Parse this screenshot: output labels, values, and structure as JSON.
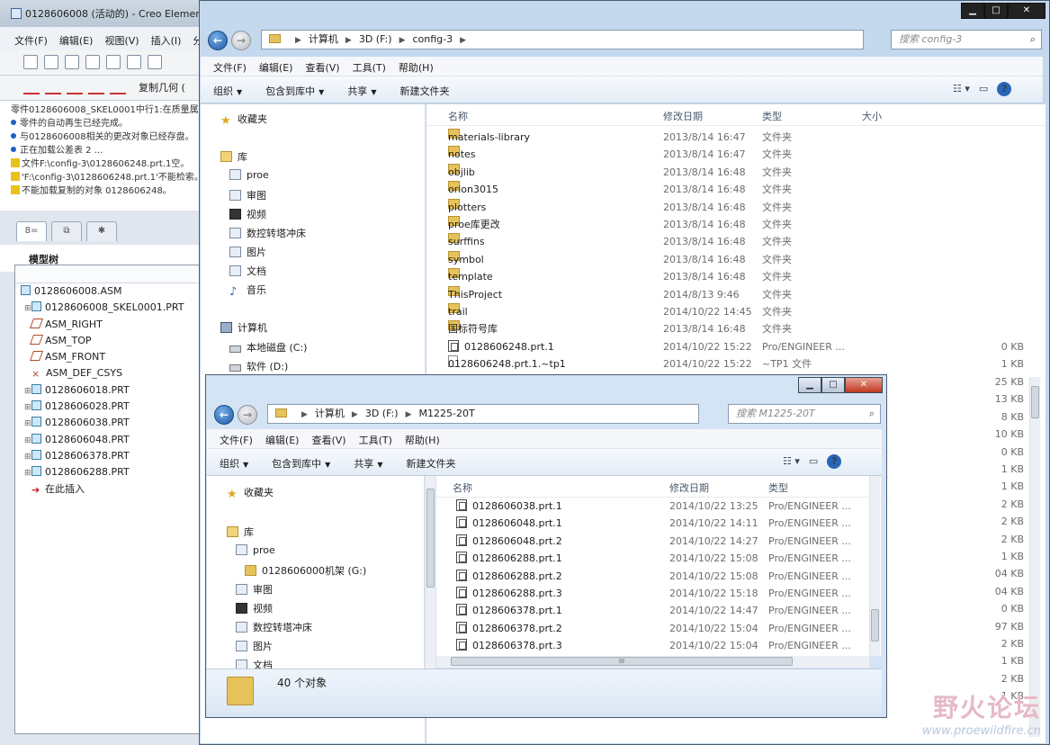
{
  "creo": {
    "title": "0128606008 (活动的) - Creo Element",
    "menu": [
      "文件(F)",
      "编辑(E)",
      "视图(V)",
      "插入(I)",
      "分"
    ],
    "toolbar_label": "复制几何 (",
    "messages": [
      {
        "kind": "plain",
        "text": "零件0128606008_SKEL0001中行1:在质量属"
      },
      {
        "kind": "dot",
        "text": "零件的自动再生已经完成。"
      },
      {
        "kind": "dot",
        "text": "与0128606008相关的更改对象已经存盘。"
      },
      {
        "kind": "dot",
        "text": "正在加载公差表 2 ..."
      },
      {
        "kind": "warn",
        "text": "文件F:\\config-3\\0128606248.prt.1空。"
      },
      {
        "kind": "warn",
        "text": "'F:\\config-3\\0128606248.prt.1'不能检索。"
      },
      {
        "kind": "warn",
        "text": "不能加载复制的对象 0128606248。"
      }
    ],
    "tree_title": "模型树",
    "tree": [
      {
        "pm": "",
        "icon": "asm",
        "label": "0128606008.ASM",
        "indent": 0
      },
      {
        "pm": "+",
        "icon": "part",
        "label": "0128606008_SKEL0001.PRT",
        "indent": 1
      },
      {
        "pm": "",
        "icon": "plane",
        "label": "ASM_RIGHT",
        "indent": 1
      },
      {
        "pm": "",
        "icon": "plane",
        "label": "ASM_TOP",
        "indent": 1
      },
      {
        "pm": "",
        "icon": "plane",
        "label": "ASM_FRONT",
        "indent": 1
      },
      {
        "pm": "",
        "icon": "csys",
        "label": "ASM_DEF_CSYS",
        "indent": 1
      },
      {
        "pm": "+",
        "icon": "part",
        "label": "0128606018.PRT",
        "indent": 1
      },
      {
        "pm": "+",
        "icon": "part",
        "label": "0128606028.PRT",
        "indent": 1
      },
      {
        "pm": "+",
        "icon": "part",
        "label": "0128606038.PRT",
        "indent": 1
      },
      {
        "pm": "+",
        "icon": "part",
        "label": "0128606048.PRT",
        "indent": 1
      },
      {
        "pm": "+",
        "icon": "part",
        "label": "0128606378.PRT",
        "indent": 1
      },
      {
        "pm": "+",
        "icon": "part",
        "label": "0128606288.PRT",
        "indent": 1
      },
      {
        "pm": "",
        "icon": "arrow",
        "label": "在此插入",
        "indent": 1
      }
    ]
  },
  "explorer1": {
    "path": [
      "计算机",
      "3D (F:)",
      "config-3"
    ],
    "search_placeholder": "搜索 config-3",
    "menu": [
      "文件(F)",
      "编辑(E)",
      "查看(V)",
      "工具(T)",
      "帮助(H)"
    ],
    "commands": [
      "组织",
      "包含到库中",
      "共享",
      "新建文件夹"
    ],
    "nav": [
      {
        "icon": "star",
        "label": "收藏夹"
      },
      {
        "icon": "lib",
        "label": "库"
      },
      {
        "icon": "doc",
        "label": "proe"
      },
      {
        "icon": "doc",
        "label": "审图"
      },
      {
        "icon": "vid",
        "label": "视频"
      },
      {
        "icon": "doc",
        "label": "数控转塔冲床"
      },
      {
        "icon": "doc",
        "label": "图片"
      },
      {
        "icon": "doc",
        "label": "文档"
      },
      {
        "icon": "music",
        "label": "音乐"
      },
      {
        "icon": "pc",
        "label": "计算机"
      },
      {
        "icon": "drv",
        "label": "本地磁盘 (C:)"
      },
      {
        "icon": "drv",
        "label": "软件 (D:)"
      }
    ],
    "columns": [
      "名称",
      "修改日期",
      "类型",
      "大小"
    ],
    "files": [
      {
        "icon": "folder",
        "name": "materials-library",
        "date": "2013/8/14 16:47",
        "type": "文件夹",
        "size": ""
      },
      {
        "icon": "folder",
        "name": "notes",
        "date": "2013/8/14 16:47",
        "type": "文件夹",
        "size": ""
      },
      {
        "icon": "folder",
        "name": "objlib",
        "date": "2013/8/14 16:48",
        "type": "文件夹",
        "size": ""
      },
      {
        "icon": "folder",
        "name": "orion3015",
        "date": "2013/8/14 16:48",
        "type": "文件夹",
        "size": ""
      },
      {
        "icon": "folder",
        "name": "plotters",
        "date": "2013/8/14 16:48",
        "type": "文件夹",
        "size": ""
      },
      {
        "icon": "folder",
        "name": "proe库更改",
        "date": "2013/8/14 16:48",
        "type": "文件夹",
        "size": ""
      },
      {
        "icon": "folder",
        "name": "surffins",
        "date": "2013/8/14 16:48",
        "type": "文件夹",
        "size": ""
      },
      {
        "icon": "folder",
        "name": "symbol",
        "date": "2013/8/14 16:48",
        "type": "文件夹",
        "size": ""
      },
      {
        "icon": "folder",
        "name": "template",
        "date": "2013/8/14 16:48",
        "type": "文件夹",
        "size": ""
      },
      {
        "icon": "folder",
        "name": "ThisProject",
        "date": "2014/8/13 9:46",
        "type": "文件夹",
        "size": ""
      },
      {
        "icon": "folder",
        "name": "trail",
        "date": "2014/10/22 14:45",
        "type": "文件夹",
        "size": ""
      },
      {
        "icon": "folder",
        "name": "国标符号库",
        "date": "2013/8/14 16:48",
        "type": "文件夹",
        "size": ""
      },
      {
        "icon": "prt",
        "name": "0128606248.prt.1",
        "date": "2014/10/22 15:22",
        "type": "Pro/ENGINEER ...",
        "size": "0 KB"
      },
      {
        "icon": "doc",
        "name": "0128606248.prt.1.~tp1",
        "date": "2014/10/22 15:22",
        "type": "~TP1 文件",
        "size": "1 KB"
      }
    ],
    "partial_sizes": [
      "25 KB",
      "13 KB",
      "8 KB",
      "10 KB",
      "0 KB",
      "1 KB",
      "1 KB",
      "2 KB",
      "2 KB",
      "2 KB",
      "1 KB",
      "04 KB",
      "04 KB",
      "0 KB",
      "97 KB",
      "2 KB",
      "1 KB",
      "2 KB",
      "1 KB"
    ]
  },
  "explorer2": {
    "path": [
      "计算机",
      "3D (F:)",
      "M1225-20T"
    ],
    "search_placeholder": "搜索 M1225-20T",
    "menu": [
      "文件(F)",
      "编辑(E)",
      "查看(V)",
      "工具(T)",
      "帮助(H)"
    ],
    "commands": [
      "组织",
      "包含到库中",
      "共享",
      "新建文件夹"
    ],
    "nav": [
      {
        "icon": "star",
        "label": "收藏夹"
      },
      {
        "icon": "lib",
        "label": "库"
      },
      {
        "icon": "doc",
        "label": "proe"
      },
      {
        "icon": "fold",
        "label": "0128606000机架 (G:)"
      },
      {
        "icon": "doc",
        "label": "审图"
      },
      {
        "icon": "vid",
        "label": "视频"
      },
      {
        "icon": "doc",
        "label": "数控转塔冲床"
      },
      {
        "icon": "doc",
        "label": "图片"
      },
      {
        "icon": "doc",
        "label": "文档"
      }
    ],
    "columns": [
      "名称",
      "修改日期",
      "类型"
    ],
    "files": [
      {
        "name": "0128606038.prt.1",
        "date": "2014/10/22 13:25",
        "type": "Pro/ENGINEER ..."
      },
      {
        "name": "0128606048.prt.1",
        "date": "2014/10/22 14:11",
        "type": "Pro/ENGINEER ..."
      },
      {
        "name": "0128606048.prt.2",
        "date": "2014/10/22 14:27",
        "type": "Pro/ENGINEER ..."
      },
      {
        "name": "0128606288.prt.1",
        "date": "2014/10/22 15:08",
        "type": "Pro/ENGINEER ..."
      },
      {
        "name": "0128606288.prt.2",
        "date": "2014/10/22 15:08",
        "type": "Pro/ENGINEER ..."
      },
      {
        "name": "0128606288.prt.3",
        "date": "2014/10/22 15:18",
        "type": "Pro/ENGINEER ..."
      },
      {
        "name": "0128606378.prt.1",
        "date": "2014/10/22 14:47",
        "type": "Pro/ENGINEER ..."
      },
      {
        "name": "0128606378.prt.2",
        "date": "2014/10/22 15:04",
        "type": "Pro/ENGINEER ..."
      },
      {
        "name": "0128606378.prt.3",
        "date": "2014/10/22 15:04",
        "type": "Pro/ENGINEER ..."
      }
    ],
    "status": "40 个对象",
    "scroll_mark": "III"
  },
  "watermark": {
    "brand": "野火论坛",
    "url": "www.proewildfire.cn"
  },
  "colors": {
    "accent": "#2a66b8",
    "folder": "#e6c35a"
  }
}
